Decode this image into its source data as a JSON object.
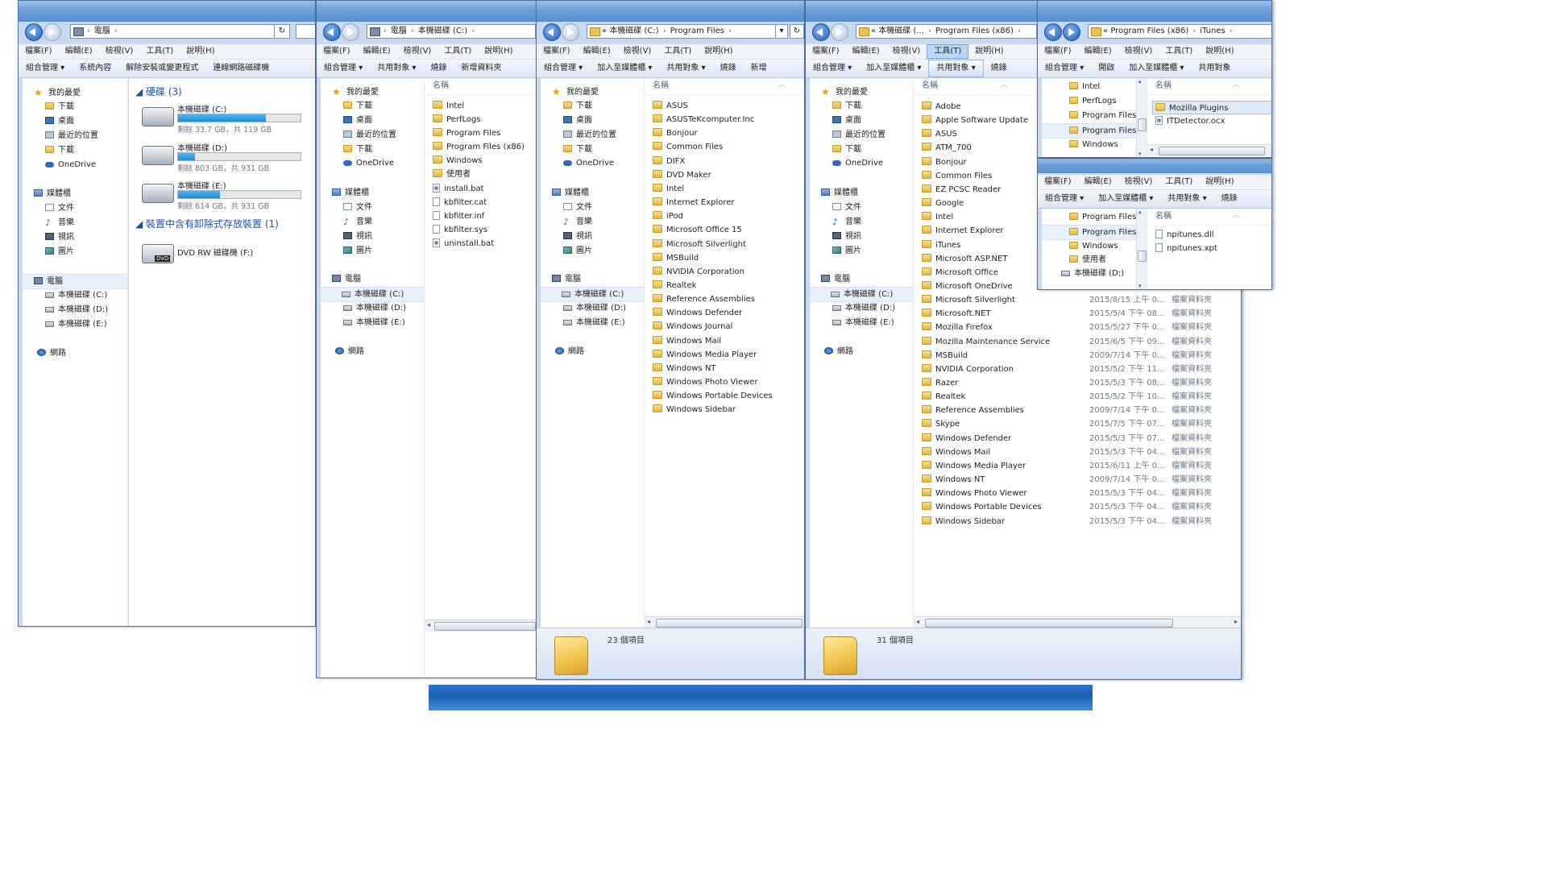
{
  "menu": [
    "檔案(F)",
    "編輯(E)",
    "檢視(V)",
    "工具(T)",
    "說明(H)"
  ],
  "nav": {
    "favorites": "我的最愛",
    "downloads": "下載",
    "desktop": "桌面",
    "recent": "最近的位置",
    "onedrive": "OneDrive",
    "libraries": "媒體櫃",
    "documents": "文件",
    "music": "音樂",
    "videos": "視訊",
    "pictures": "圖片",
    "computer": "電腦",
    "drive_c": "本機磁碟 (C:)",
    "drive_d": "本機磁碟 (D:)",
    "drive_e": "本機磁碟 (E:)",
    "network": "網路"
  },
  "win1": {
    "address": [
      "電腦"
    ],
    "commands": [
      "組合管理 ▾",
      "系統內容",
      "解除安裝或變更程式",
      "連線網路磁碟機"
    ],
    "hard_disks": "硬碟 (3)",
    "removable": "裝置中含有卸除式存放裝置 (1)",
    "drives": [
      {
        "name": "本機磁碟 (C:)",
        "free": "剩餘 33.7 GB，共 119 GB",
        "used": 0.72
      },
      {
        "name": "本機磁碟 (D:)",
        "free": "剩餘 803 GB，共 931 GB",
        "used": 0.14
      },
      {
        "name": "本機磁碟 (E:)",
        "free": "剩餘 614 GB，共 931 GB",
        "used": 0.34
      }
    ],
    "dvd": "DVD RW 磁碟機 (F:)"
  },
  "win2": {
    "address": [
      "電腦",
      "本機磁碟 (C:)"
    ],
    "commands": [
      "組合管理 ▾",
      "共用對象 ▾",
      "燒錄",
      "新增資料夾"
    ],
    "col_name": "名稱",
    "folders": [
      "Intel",
      "PerfLogs",
      "Program Files",
      "Program Files (x86)",
      "Windows",
      "使用者"
    ],
    "files": [
      "install.bat",
      "kbfilter.cat",
      "kbfilter.inf",
      "kbfilter.sys",
      "uninstall.bat"
    ]
  },
  "win3": {
    "address": [
      "«",
      "本機磁碟 (C:)",
      "Program Files"
    ],
    "commands": [
      "組合管理 ▾",
      "加入至媒體櫃 ▾",
      "共用對象 ▾",
      "燒錄",
      "新增"
    ],
    "col_name": "名稱",
    "folders": [
      "ASUS",
      "ASUSTeKcomputer.Inc",
      "Bonjour",
      "Common Files",
      "DIFX",
      "DVD Maker",
      "Intel",
      "Internet Explorer",
      "iPod",
      "Microsoft Office 15",
      "Microsoft Silverlight",
      "MSBuild",
      "NVIDIA Corporation",
      "Realtek",
      "Reference Assemblies",
      "Windows Defender",
      "Windows Journal",
      "Windows Mail",
      "Windows Media Player",
      "Windows NT",
      "Windows Photo Viewer",
      "Windows Portable Devices",
      "Windows Sidebar"
    ],
    "count": "23 個項目"
  },
  "win4": {
    "address": [
      "«",
      "本機磁碟 (...",
      "Program Files (x86)"
    ],
    "commands": [
      "組合管理 ▾",
      "加入至媒體櫃 ▾",
      "共用對象 ▾",
      "燒錄"
    ],
    "col_name": "名稱",
    "folders": [
      {
        "n": "Adobe",
        "d": "",
        "t": ""
      },
      {
        "n": "Apple Software Update",
        "d": "",
        "t": ""
      },
      {
        "n": "ASUS",
        "d": "",
        "t": ""
      },
      {
        "n": "ATM_700",
        "d": "",
        "t": ""
      },
      {
        "n": "Bonjour",
        "d": "",
        "t": ""
      },
      {
        "n": "Common Files",
        "d": "",
        "t": ""
      },
      {
        "n": "EZ PCSC Reader",
        "d": "",
        "t": ""
      },
      {
        "n": "Google",
        "d": "",
        "t": ""
      },
      {
        "n": "Intel",
        "d": "",
        "t": ""
      },
      {
        "n": "Internet Explorer",
        "d": "",
        "t": ""
      },
      {
        "n": "iTunes",
        "d": "",
        "t": ""
      },
      {
        "n": "Microsoft ASP.NET",
        "d": "",
        "t": ""
      },
      {
        "n": "Microsoft Office",
        "d": "",
        "t": ""
      },
      {
        "n": "Microsoft OneDrive",
        "d": "",
        "t": ""
      },
      {
        "n": "Microsoft Silverlight",
        "d": "2015/8/15 上午 0...",
        "t": "檔案資料夾"
      },
      {
        "n": "Microsoft.NET",
        "d": "2015/5/4 下午 08...",
        "t": "檔案資料夾"
      },
      {
        "n": "Mozilla Firefox",
        "d": "2015/5/27 下午 0...",
        "t": "檔案資料夾"
      },
      {
        "n": "Mozilla Maintenance Service",
        "d": "2015/6/5 下午 09...",
        "t": "檔案資料夾"
      },
      {
        "n": "MSBuild",
        "d": "2009/7/14 下午 0...",
        "t": "檔案資料夾"
      },
      {
        "n": "NVIDIA Corporation",
        "d": "2015/5/2 下午 11...",
        "t": "檔案資料夾"
      },
      {
        "n": "Razer",
        "d": "2015/5/3 下午 08...",
        "t": "檔案資料夾"
      },
      {
        "n": "Realtek",
        "d": "2015/5/2 下午 10...",
        "t": "檔案資料夾"
      },
      {
        "n": "Reference Assemblies",
        "d": "2009/7/14 下午 0...",
        "t": "檔案資料夾"
      },
      {
        "n": "Skype",
        "d": "2015/7/5 下午 07...",
        "t": "檔案資料夾"
      },
      {
        "n": "Windows Defender",
        "d": "2015/5/3 下午 07...",
        "t": "檔案資料夾"
      },
      {
        "n": "Windows Mail",
        "d": "2015/5/3 下午 04...",
        "t": "檔案資料夾"
      },
      {
        "n": "Windows Media Player",
        "d": "2015/6/11 上午 0...",
        "t": "檔案資料夾"
      },
      {
        "n": "Windows NT",
        "d": "2009/7/14 下午 0...",
        "t": "檔案資料夾"
      },
      {
        "n": "Windows Photo Viewer",
        "d": "2015/5/3 下午 04...",
        "t": "檔案資料夾"
      },
      {
        "n": "Windows Portable Devices",
        "d": "2015/5/3 下午 04...",
        "t": "檔案資料夾"
      },
      {
        "n": "Windows Sidebar",
        "d": "2015/5/3 下午 04...",
        "t": "檔案資料夾"
      }
    ],
    "count": "31 個項目"
  },
  "win5": {
    "address": [
      "«",
      "Program Files (x86)",
      "iTunes"
    ],
    "commands": [
      "組合管理 ▾",
      "開啟",
      "加入至媒體櫃 ▾",
      "共用對象"
    ],
    "col_name": "名稱",
    "tree": [
      "Intel",
      "PerfLogs",
      "Program Files",
      "Program Files",
      "Windows"
    ],
    "items": [
      "Mozilla Plugins",
      "ITDetector.ocx"
    ]
  },
  "win6": {
    "commands": [
      "組合管理 ▾",
      "加入至媒體櫃 ▾",
      "共用對象 ▾",
      "燒錄"
    ],
    "col_name": "名稱",
    "tree": [
      "Program Files",
      "Program Files",
      "Windows",
      "使用者",
      "本機磁碟 (D:)"
    ],
    "items": [
      "npitunes.dll",
      "npitunes.xpt"
    ]
  }
}
